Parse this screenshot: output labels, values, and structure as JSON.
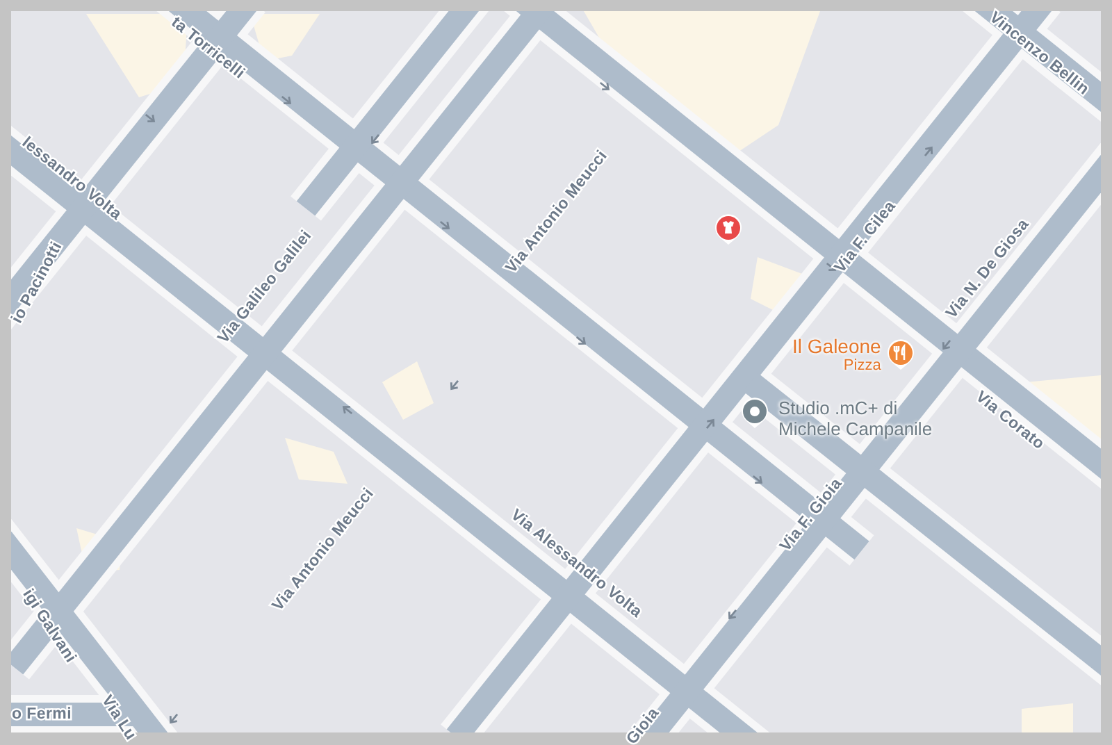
{
  "map": {
    "streets": [
      {
        "name": "ta Torricelli"
      },
      {
        "name": "Vincenzo Bellin"
      },
      {
        "name": "lessandro Volta"
      },
      {
        "name": "Via Antonio Meucci"
      },
      {
        "name": "Via F. Cilea"
      },
      {
        "name": "io Pacinotti"
      },
      {
        "name": "Via Galileo Galilei"
      },
      {
        "name": "Via N. De Giosa"
      },
      {
        "name": "Via Corato"
      },
      {
        "name": "Via F. Gioia"
      },
      {
        "name": "Via Antonio Meucci"
      },
      {
        "name": "Via Alessandro Volta"
      },
      {
        "name": "igi Galvani"
      },
      {
        "name": "Via Lu"
      },
      {
        "name": "o Fermi"
      },
      {
        "name": "Gioia"
      }
    ],
    "pois": [
      {
        "kind": "shop",
        "color": "#e84848"
      },
      {
        "kind": "restaurant",
        "name": "Il Galeone",
        "category": "Pizza",
        "color": "#f0883a"
      },
      {
        "kind": "place",
        "name": "Studio .mC+ di Michele Campanile",
        "color": "#75868f"
      }
    ]
  }
}
